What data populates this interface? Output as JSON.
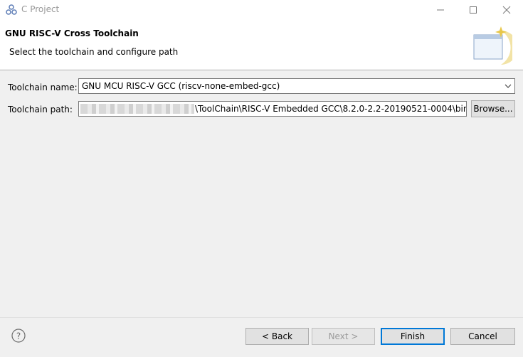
{
  "window": {
    "title": "C Project"
  },
  "banner": {
    "title": "GNU RISC-V Cross Toolchain",
    "description": "Select the toolchain and configure path"
  },
  "form": {
    "toolchain_name_label": "Toolchain name:",
    "toolchain_name_value": "GNU MCU RISC-V GCC (riscv-none-embed-gcc)",
    "toolchain_path_label": "Toolchain path:",
    "toolchain_path_value": "\\ToolChain\\RISC-V Embedded GCC\\8.2.0-2.2-20190521-0004\\bin",
    "browse_label": "Browse..."
  },
  "footer": {
    "back_label": "< Back",
    "next_label": "Next >",
    "finish_label": "Finish",
    "cancel_label": "Cancel"
  },
  "icons": {
    "app": "eclipse-cdt-icon",
    "minimize": "minimize-icon",
    "maximize": "maximize-icon",
    "close": "close-icon",
    "wizard": "wizard-banner-icon",
    "help": "help-icon",
    "dropdown": "chevron-down-icon"
  },
  "colors": {
    "default_button_border": "#0078d7",
    "window_bg": "#f0f0f0"
  }
}
